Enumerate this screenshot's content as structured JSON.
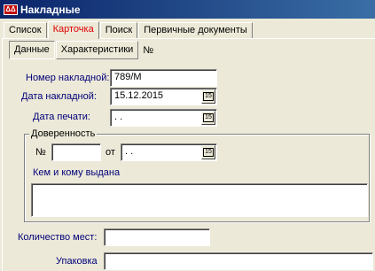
{
  "window": {
    "title": "Накладные",
    "icon": "app-icon"
  },
  "tabs": [
    {
      "label": "Список"
    },
    {
      "label": "Карточка"
    },
    {
      "label": "Поиск"
    },
    {
      "label": "Первичные документы"
    }
  ],
  "subtabs": [
    {
      "label": "Данные"
    },
    {
      "label": "Характеристики"
    }
  ],
  "subtab_suffix": "№",
  "form": {
    "invoice_number_label": "Номер накладной:",
    "invoice_number_value": "789/М",
    "invoice_date_label": "Дата накладной:",
    "invoice_date_value": "15.12.2015",
    "print_date_label": "Дата печати:",
    "print_date_value": " .  .",
    "calendar_button": "15",
    "poa": {
      "legend": "Доверенность",
      "number_label": "№",
      "number_value": "",
      "from_label": "от",
      "date_value": " .  .",
      "issued_label": "Кем и кому выдана",
      "issued_value": ""
    },
    "places_label": "Количество мест:",
    "places_value": "",
    "package_label": "Упаковка",
    "package_value": ""
  },
  "colors": {
    "field_label": "#00007a",
    "active_tab": "#e00000",
    "titlebar": "#0a246a"
  }
}
